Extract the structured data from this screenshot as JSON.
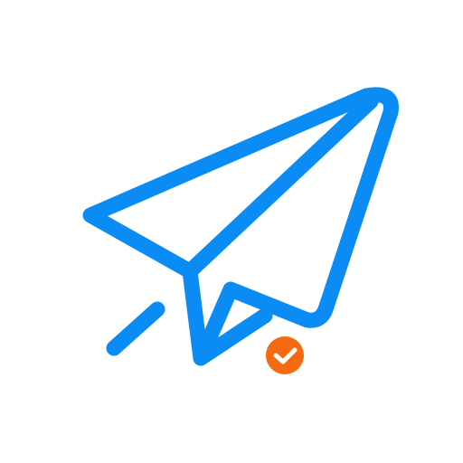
{
  "icon": {
    "name": "paper-plane-sent-icon",
    "badge_name": "check-badge-icon"
  },
  "colors": {
    "background": "#ffffff",
    "plane_stroke": "#0a8cf4",
    "badge_fill": "#f36a12",
    "check_stroke": "#ffffff"
  }
}
